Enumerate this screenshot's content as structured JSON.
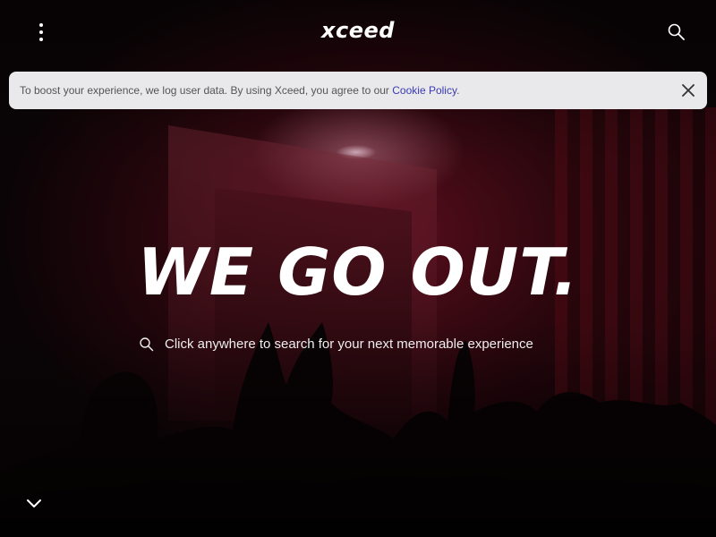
{
  "header": {
    "logo_text": "xceed",
    "menu_icon": "more-vertical-icon",
    "search_icon": "search-icon"
  },
  "cookie_banner": {
    "text": "To boost your experience, we log user data. By using Xceed, you agree to our",
    "link_label": "Cookie Policy",
    "trailing": ".",
    "close_icon": "close-icon"
  },
  "hero": {
    "headline": "WE GO OUT.",
    "search_prompt": "Click anywhere to search for your next memorable experience",
    "search_icon": "search-icon",
    "scroll_icon": "chevron-down-icon",
    "accent_color": "#3a3ab5"
  }
}
